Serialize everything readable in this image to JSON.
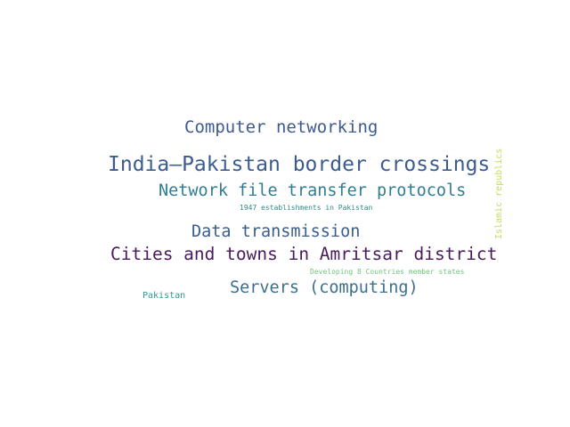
{
  "word_cloud": {
    "words": [
      {
        "id": "computer_networking",
        "text": "Computer networking",
        "color": "#3e5a8f"
      },
      {
        "id": "border_crossings",
        "text": "India–Pakistan border crossings",
        "color": "#3c5b8e"
      },
      {
        "id": "file_transfer",
        "text": "Network file transfer protocols",
        "color": "#2f7e95"
      },
      {
        "id": "establishments_1947",
        "text": "1947 establishments in Pakistan",
        "color": "#2c8a86"
      },
      {
        "id": "data_transmission",
        "text": "Data transmission",
        "color": "#3b5d8c"
      },
      {
        "id": "amritsar",
        "text": "Cities and towns in Amritsar district",
        "color": "#4a1a5e"
      },
      {
        "id": "d8",
        "text": "Developing 8 Countries member states",
        "color": "#6fc47e"
      },
      {
        "id": "servers",
        "text": "Servers (computing)",
        "color": "#3a6f8e"
      },
      {
        "id": "pakistan",
        "text": "Pakistan",
        "color": "#2b9a8c"
      },
      {
        "id": "islamic_republics",
        "text": "Islamic republics",
        "color": "#cbd85a"
      }
    ]
  }
}
